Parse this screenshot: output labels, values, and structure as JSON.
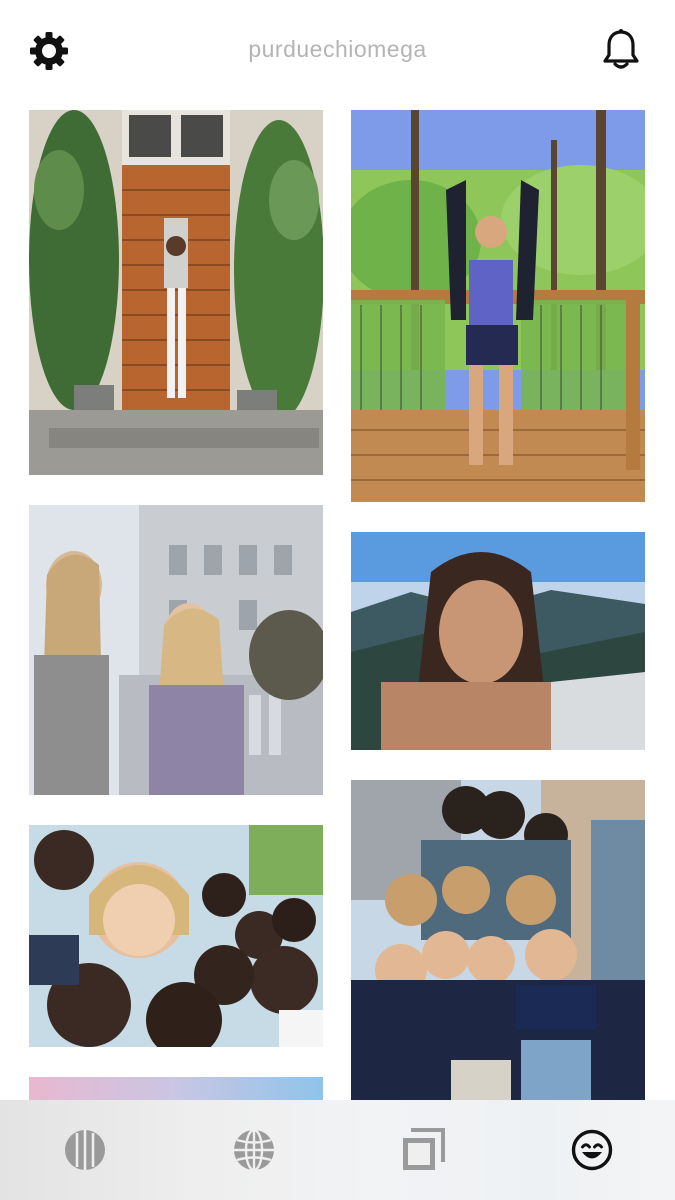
{
  "header": {
    "username": "purduechiomega",
    "settings_icon": "gear-icon",
    "notifications_icon": "bell-icon"
  },
  "tabbar": {
    "tabs": [
      {
        "icon": "columns-icon",
        "active": false
      },
      {
        "icon": "globe-icon",
        "active": false
      },
      {
        "icon": "stacked-photos-icon",
        "active": false
      },
      {
        "icon": "smiley-icon",
        "active": true
      }
    ]
  },
  "colors": {
    "active_icon": "#111111",
    "inactive_icon": "#9a9a9a",
    "username_text": "#b4b4b4"
  }
}
